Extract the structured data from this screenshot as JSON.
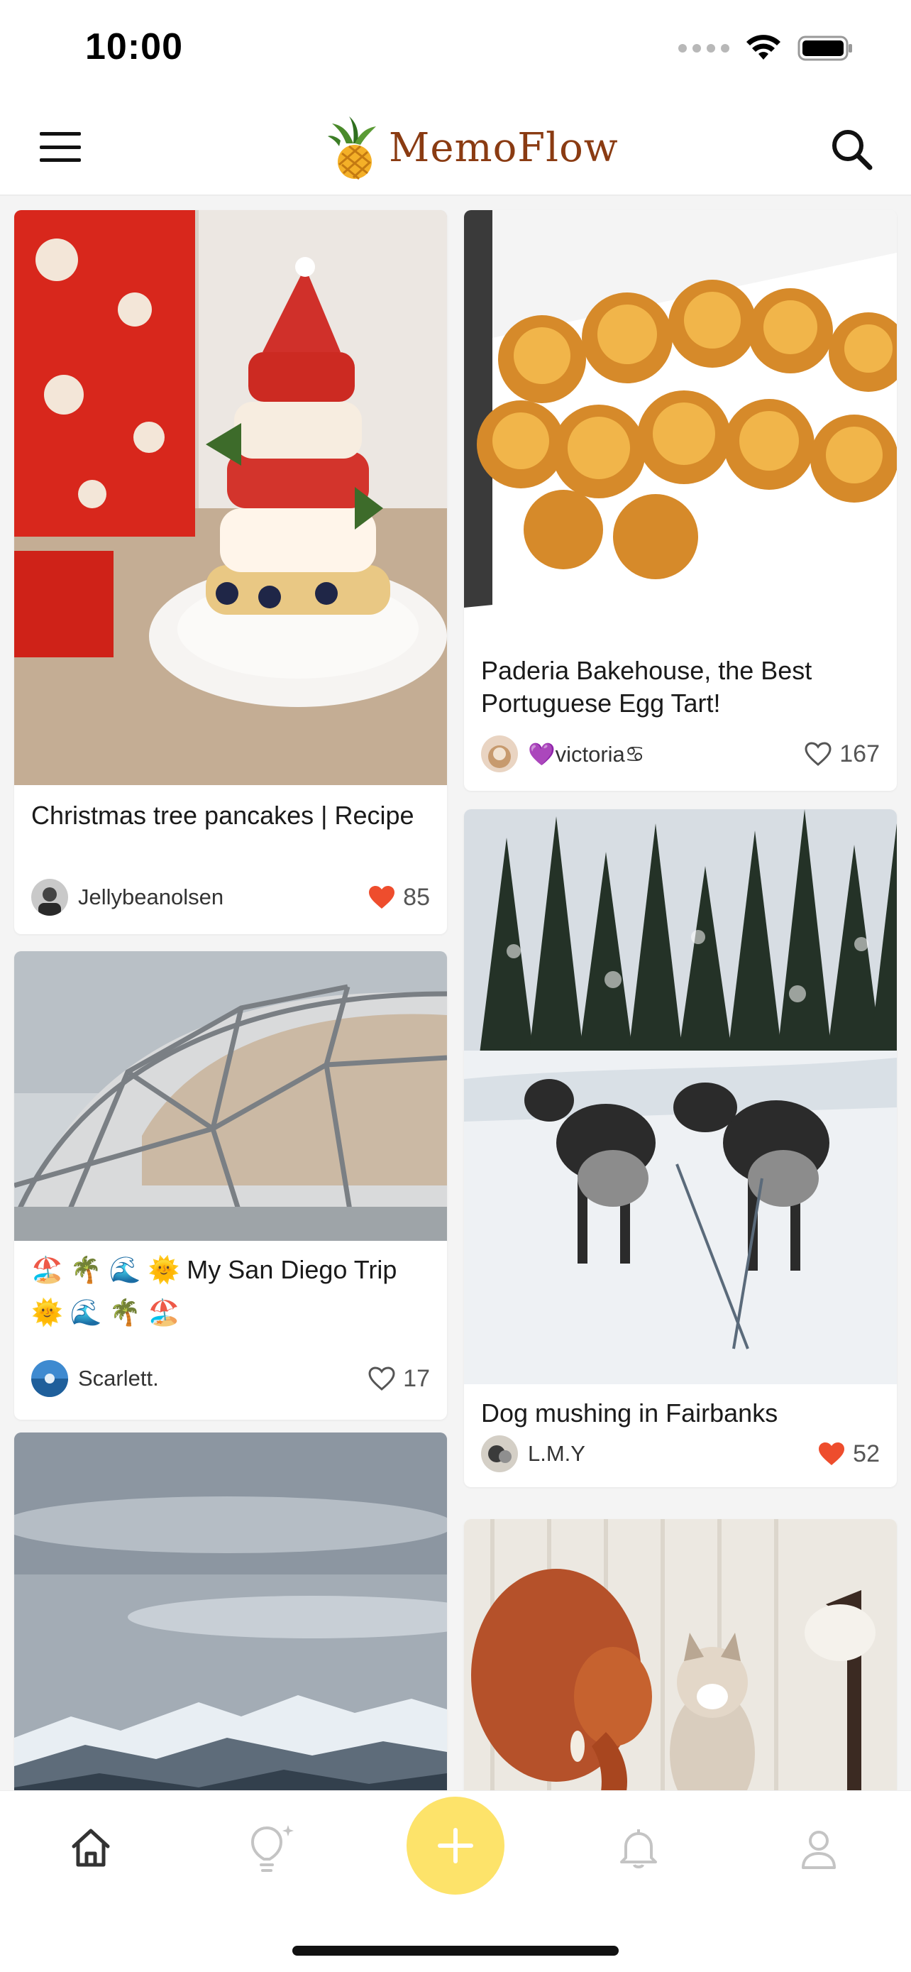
{
  "status_bar": {
    "time": "10:00"
  },
  "header": {
    "app_name": "MemoFlow",
    "logo_icon": "pineapple-icon"
  },
  "feed": {
    "left_column": [
      {
        "title": "Christmas tree pancakes | Recipe",
        "author": "Jellybeanolsen",
        "likes": "85",
        "liked": true,
        "image": "christmas-tree-pancakes-photo"
      },
      {
        "title": "🏖️ 🌴 🌊 🌞 My San Diego Trip",
        "title_line2": "🌞 🌊 🌴 🏖️",
        "author": "Scarlett.",
        "likes": "17",
        "liked": false,
        "image": "geodesic-dome-photo"
      },
      {
        "image": "snowy-mountains-photo"
      }
    ],
    "right_column": [
      {
        "title": "Paderia Bakehouse, the Best Portuguese Egg Tart!",
        "author": "💜victoria♋",
        "likes": "167",
        "liked": false,
        "image": "egg-tarts-photo"
      },
      {
        "title": "Dog mushing in Fairbanks",
        "author": "L.M.Y",
        "likes": "52",
        "liked": true,
        "image": "sled-dogs-photo"
      },
      {
        "image": "cat-and-elephant-photo"
      }
    ]
  },
  "bottom_nav": {
    "items": [
      "home-icon",
      "lightbulb-icon",
      "add-icon",
      "bell-icon",
      "profile-icon"
    ],
    "add_color": "#fde36a"
  },
  "colors": {
    "like_red": "#ee4d2d",
    "brand_brown": "#8a3b12"
  }
}
